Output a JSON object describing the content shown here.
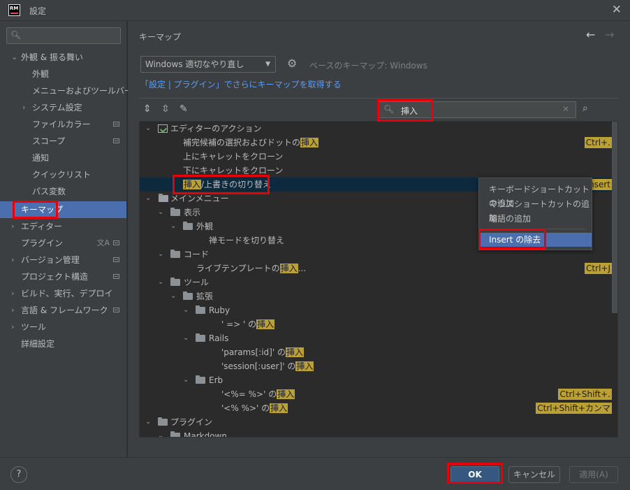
{
  "window": {
    "title": "設定",
    "logo_text": "RM"
  },
  "sidebar": {
    "search": {
      "placeholder": "",
      "value": ""
    },
    "items": [
      {
        "label": "外観 & 振る舞い",
        "expanded": true
      },
      {
        "label": "外観"
      },
      {
        "label": "メニューおよびツールバー"
      },
      {
        "label": "システム設定",
        "collapsed": true
      },
      {
        "label": "ファイルカラー"
      },
      {
        "label": "スコープ"
      },
      {
        "label": "通知"
      },
      {
        "label": "クイックリスト"
      },
      {
        "label": "パス変数"
      },
      {
        "label": "キーマップ",
        "selected": true
      },
      {
        "label": "エディター",
        "collapsed": true
      },
      {
        "label": "プラグイン"
      },
      {
        "label": "バージョン管理",
        "collapsed": true
      },
      {
        "label": "プロジェクト構造"
      },
      {
        "label": "ビルド、実行、デプロイ",
        "collapsed": true
      },
      {
        "label": "言語 & フレームワーク",
        "collapsed": true
      },
      {
        "label": "ツール",
        "collapsed": true
      },
      {
        "label": "詳細設定"
      }
    ]
  },
  "main": {
    "heading": "キーマップ",
    "keymap_select": "Windows 適切なやり直し",
    "base_keymap": "ベースのキーマップ: Windows",
    "get_more_link": "「設定 | プラグイン」でさらにキーマップを取得する",
    "filter": {
      "value": "挿入"
    },
    "tree": [
      {
        "text": "エディターのアクション",
        "type": "editor-group"
      },
      {
        "pre": "補完候補の選択およびドットの",
        "hl": "挿入",
        "post": "",
        "shortcut": "Ctrl+."
      },
      {
        "pre": "上にキャレットをクローン",
        "hl": "",
        "post": ""
      },
      {
        "pre": "下にキャレットをクローン",
        "hl": "",
        "post": ""
      },
      {
        "pre": "",
        "hl": "挿入",
        "post": "/上書きの切り替え",
        "shortcut": "Insert",
        "selected": true
      },
      {
        "text": "メインメニュー",
        "type": "menu-group"
      },
      {
        "text": "表示",
        "type": "folder"
      },
      {
        "text": "外観",
        "type": "folder"
      },
      {
        "pre": "禅モードを切り替え",
        "hl": "",
        "post": ""
      },
      {
        "text": "コード",
        "type": "folder"
      },
      {
        "pre": "ライブテンプレートの",
        "hl": "挿入",
        "post": "...",
        "shortcut": "Ctrl+J"
      },
      {
        "text": "ツール",
        "type": "folder"
      },
      {
        "text": "拡張",
        "type": "folder"
      },
      {
        "text": "Ruby",
        "type": "folder"
      },
      {
        "pre": "' => ' の",
        "hl": "挿入",
        "post": ""
      },
      {
        "text": "Rails",
        "type": "folder"
      },
      {
        "pre": "'params[:id]' の",
        "hl": "挿入",
        "post": ""
      },
      {
        "pre": "'session[:user]' の",
        "hl": "挿入",
        "post": ""
      },
      {
        "text": "Erb",
        "type": "folder"
      },
      {
        "pre": "'<%= %>' の",
        "hl": "挿入",
        "post": "",
        "shortcut": "Ctrl+Shift+."
      },
      {
        "pre": "'<% %>' の",
        "hl": "挿入",
        "post": "",
        "shortcut": "Ctrl+Shift+カンマ"
      },
      {
        "text": "プラグイン",
        "type": "folder"
      },
      {
        "text": "Markdown",
        "type": "folder"
      }
    ]
  },
  "context_menu": {
    "items": [
      "キーボードショートカットの追加",
      "マウスショートカットの追加",
      "略語の追加",
      "Insert の除去"
    ]
  },
  "footer": {
    "ok": "OK",
    "cancel": "キャンセル",
    "apply": "適用(A)",
    "help": "?"
  },
  "colors": {
    "accent": "#4b6eaf",
    "highlight": "#bba036",
    "annotation": "#e8000b",
    "link": "#589df6"
  }
}
